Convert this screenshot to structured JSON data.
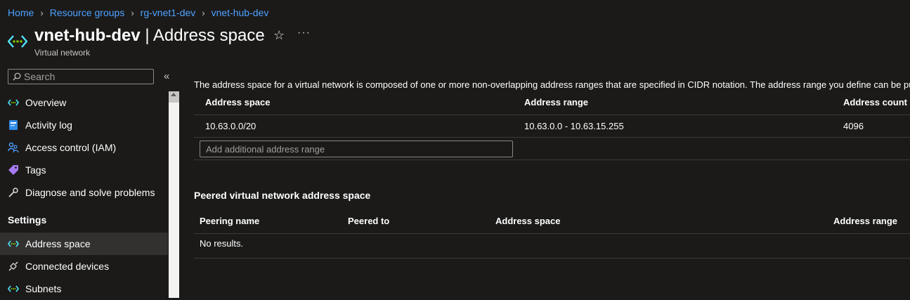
{
  "breadcrumb": [
    "Home",
    "Resource groups",
    "rg-vnet1-dev",
    "vnet-hub-dev"
  ],
  "header": {
    "resource_name": "vnet-hub-dev",
    "separator": "|",
    "page_name": "Address space",
    "subtitle": "Virtual network"
  },
  "sidebar": {
    "search_placeholder": "Search",
    "items": [
      {
        "label": "Overview",
        "icon": "vnet-icon"
      },
      {
        "label": "Activity log",
        "icon": "activity-log-icon"
      },
      {
        "label": "Access control (IAM)",
        "icon": "iam-icon"
      },
      {
        "label": "Tags",
        "icon": "tag-icon"
      },
      {
        "label": "Diagnose and solve problems",
        "icon": "wrench-icon"
      }
    ],
    "settings_header": "Settings",
    "settings_items": [
      {
        "label": "Address space",
        "icon": "vnet-icon",
        "active": true
      },
      {
        "label": "Connected devices",
        "icon": "plug-icon"
      },
      {
        "label": "Subnets",
        "icon": "vnet-icon"
      }
    ]
  },
  "main": {
    "description": "The address space for a virtual network is composed of one or more non-overlapping address ranges that are specified in CIDR notation. The address range you define can be pub",
    "address_table": {
      "columns": [
        "Address space",
        "Address range",
        "Address count"
      ],
      "rows": [
        [
          "10.63.0.0/20",
          "10.63.0.0 - 10.63.15.255",
          "4096"
        ]
      ],
      "add_placeholder": "Add additional address range"
    },
    "peered": {
      "title": "Peered virtual network address space",
      "columns": [
        "Peering name",
        "Peered to",
        "Address space",
        "Address range"
      ],
      "empty_text": "No results."
    }
  },
  "colors": {
    "background": "#1b1a19",
    "link": "#4ea1ff",
    "active_nav": "#323130",
    "vnet_icon_blue": "#50e6ff",
    "vnet_icon_green": "#7fba00"
  }
}
